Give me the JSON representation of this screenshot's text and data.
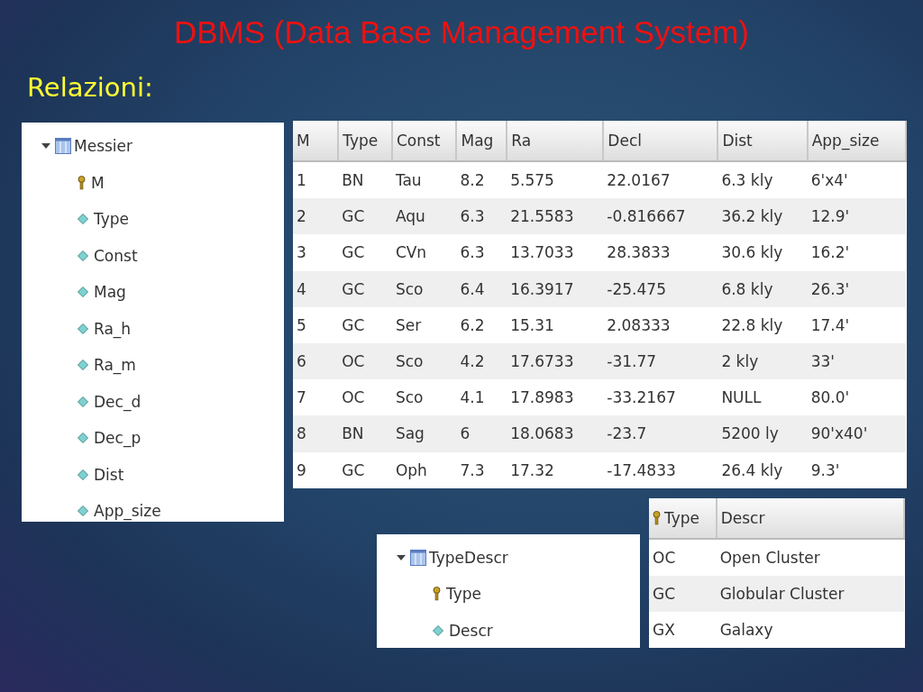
{
  "slide": {
    "title": "DBMS (Data Base Management System)",
    "subtitle": "Relazioni:"
  },
  "schema_trees": [
    {
      "label": "Messier",
      "kind": "table",
      "expanded": true,
      "children": [
        {
          "label": "M",
          "kind": "key"
        },
        {
          "label": "Type",
          "kind": "column"
        },
        {
          "label": "Const",
          "kind": "column"
        },
        {
          "label": "Mag",
          "kind": "column"
        },
        {
          "label": "Ra_h",
          "kind": "column"
        },
        {
          "label": "Ra_m",
          "kind": "column"
        },
        {
          "label": "Dec_d",
          "kind": "column"
        },
        {
          "label": "Dec_p",
          "kind": "column"
        },
        {
          "label": "Dist",
          "kind": "column"
        },
        {
          "label": "App_size",
          "kind": "column"
        }
      ]
    },
    {
      "label": "TypeDescr",
      "kind": "table",
      "expanded": true,
      "children": [
        {
          "label": "Type",
          "kind": "key"
        },
        {
          "label": "Descr",
          "kind": "column"
        }
      ]
    }
  ],
  "messier_table": {
    "columns": [
      {
        "label": "M",
        "key": false
      },
      {
        "label": "Type",
        "key": false
      },
      {
        "label": "Const",
        "key": false
      },
      {
        "label": "Mag",
        "key": false
      },
      {
        "label": "Ra",
        "key": false
      },
      {
        "label": "Decl",
        "key": false
      },
      {
        "label": "Dist",
        "key": false
      },
      {
        "label": "App_size",
        "key": false
      }
    ],
    "rows": [
      [
        "1",
        "BN",
        "Tau",
        "8.2",
        "5.575",
        "22.0167",
        "6.3 kly",
        "6'x4'"
      ],
      [
        "2",
        "GC",
        "Aqu",
        "6.3",
        "21.5583",
        "-0.816667",
        "36.2 kly",
        "12.9'"
      ],
      [
        "3",
        "GC",
        "CVn",
        "6.3",
        "13.7033",
        "28.3833",
        "30.6 kly",
        "16.2'"
      ],
      [
        "4",
        "GC",
        "Sco",
        "6.4",
        "16.3917",
        "-25.475",
        "6.8 kly",
        "26.3'"
      ],
      [
        "5",
        "GC",
        "Ser",
        "6.2",
        "15.31",
        "2.08333",
        "22.8 kly",
        "17.4'"
      ],
      [
        "6",
        "OC",
        "Sco",
        "4.2",
        "17.6733",
        "-31.77",
        "2 kly",
        "33'"
      ],
      [
        "7",
        "OC",
        "Sco",
        "4.1",
        "17.8983",
        "-33.2167",
        "NULL",
        "80.0'"
      ],
      [
        "8",
        "BN",
        "Sag",
        "6",
        "18.0683",
        "-23.7",
        "5200 ly",
        "90'x40'"
      ],
      [
        "9",
        "GC",
        "Oph",
        "7.3",
        "17.32",
        "-17.4833",
        "26.4 kly",
        "9.3'"
      ]
    ]
  },
  "typedescr_table": {
    "columns": [
      {
        "label": "Type",
        "key": true
      },
      {
        "label": "Descr",
        "key": false
      }
    ],
    "rows": [
      [
        "OC",
        "Open Cluster"
      ],
      [
        "GC",
        "Globular Cluster"
      ],
      [
        "GX",
        "Galaxy"
      ]
    ]
  }
}
